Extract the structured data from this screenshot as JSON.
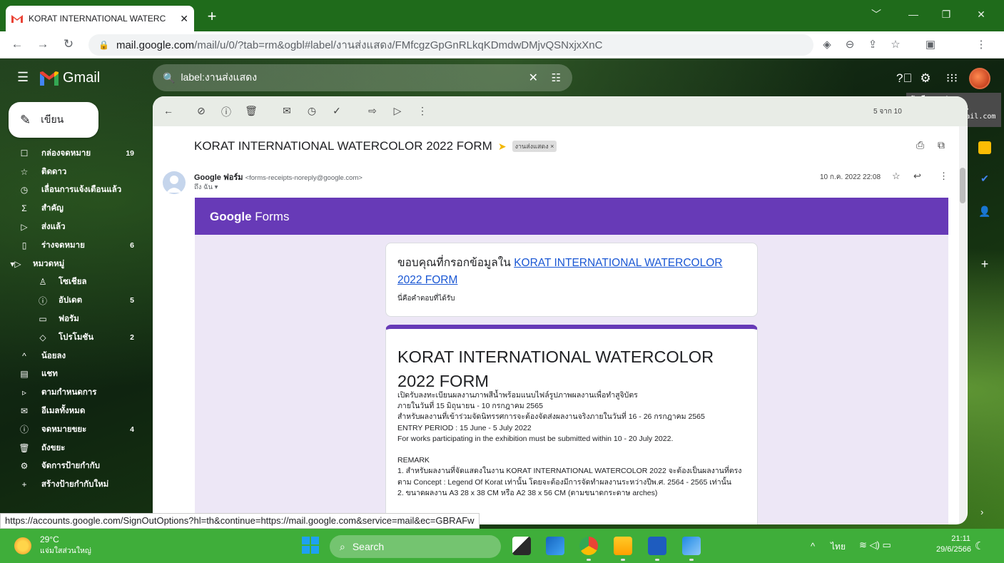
{
  "browser": {
    "tab_title": "KORAT INTERNATIONAL WATERC",
    "tab_close": "✕",
    "new_tab": "+",
    "url_host": "mail.google.com",
    "url_path": "/mail/u/0/?tab=rm&ogbl#label/งานส่งแสดง/FMfcgzGpGnRLkqKDmdwDMjvQSNxjxXnC",
    "status_url": "https://accounts.google.com/SignOutOptions?hl=th&continue=https://mail.google.com&service=mail&ec=GBRAFw"
  },
  "gmail": {
    "app_name": "Gmail",
    "search_query": "label:งานส่งแสดง",
    "account_tooltip": {
      "title": "บัญชี Google",
      "name": "จุฑารัตน์ บุตรเมียน",
      "email": "jutarut.bu@gmail.com"
    },
    "compose_label": "เขียน",
    "sidebar": [
      {
        "icon": "☐",
        "label": "กล่องจดหมาย",
        "count": "19",
        "icon_name": "inbox-icon"
      },
      {
        "icon": "☆",
        "label": "ติดดาว",
        "count": "",
        "icon_name": "star-icon"
      },
      {
        "icon": "◷",
        "label": "เลื่อนการแจ้งเตือนแล้ว",
        "count": "",
        "icon_name": "snooze-icon"
      },
      {
        "icon": "Σ",
        "label": "สำคัญ",
        "count": "",
        "icon_name": "important-icon"
      },
      {
        "icon": "▷",
        "label": "ส่งแล้ว",
        "count": "",
        "icon_name": "sent-icon"
      },
      {
        "icon": "▯",
        "label": "ร่างจดหมาย",
        "count": "6",
        "icon_name": "drafts-icon"
      },
      {
        "icon": "▾▷",
        "label": "หมวดหมู่",
        "count": "",
        "icon_name": "categories-icon"
      },
      {
        "icon": "♙",
        "label": "โซเชียล",
        "count": "",
        "icon_name": "social-icon",
        "sub": true
      },
      {
        "icon": "ⓘ",
        "label": "อัปเดต",
        "count": "5",
        "icon_name": "updates-icon",
        "sub": true
      },
      {
        "icon": "▭",
        "label": "ฟอรัม",
        "count": "",
        "icon_name": "forums-icon",
        "sub": true
      },
      {
        "icon": "◇",
        "label": "โปรโมชัน",
        "count": "2",
        "icon_name": "promotions-icon",
        "sub": true
      },
      {
        "icon": "^",
        "label": "น้อยลง",
        "count": "",
        "icon_name": "less-icon"
      },
      {
        "icon": "▤",
        "label": "แชท",
        "count": "",
        "icon_name": "chat-icon"
      },
      {
        "icon": "▹",
        "label": "ตามกำหนดการ",
        "count": "",
        "icon_name": "scheduled-icon"
      },
      {
        "icon": "✉",
        "label": "อีเมลทั้งหมด",
        "count": "",
        "icon_name": "all-mail-icon"
      },
      {
        "icon": "ⓘ",
        "label": "จดหมายขยะ",
        "count": "4",
        "icon_name": "spam-icon"
      },
      {
        "icon": "🗑",
        "label": "ถังขยะ",
        "count": "",
        "icon_name": "trash-icon"
      },
      {
        "icon": "⚙",
        "label": "จัดการป้ายกำกับ",
        "count": "",
        "icon_name": "manage-labels-icon"
      },
      {
        "icon": "+",
        "label": "สร้างป้ายกำกับใหม่",
        "count": "",
        "icon_name": "create-label-icon"
      }
    ],
    "pager": "5 จาก 10",
    "email": {
      "subject": "KORAT INTERNATIONAL WATERCOLOR 2022 FORM",
      "label_chip": "งานส่งแสดง ×",
      "sender_name": "Google ฟอร์ม",
      "sender_email": "<forms-receipts-noreply@google.com>",
      "to": "ถึง ฉัน ▾",
      "date": "10 ก.ค. 2022 22:08"
    },
    "forms": {
      "logo_google": "Google",
      "logo_forms": " Forms",
      "thanks_prefix": "ขอบคุณที่กรอกข้อมูลใน ",
      "thanks_link": "KORAT INTERNATIONAL WATERCOLOR 2022  FORM",
      "received": "นี่คือคำตอบที่ได้รับ",
      "form_title": "KORAT INTERNATIONAL WATERCOLOR 2022  FORM",
      "description": "เปิดรับลงทะเบียนผลงานภาพสีน้ำพร้อมแนบไฟล์รูปภาพผลงานเพื่อทำสูจิบัตร\nภายในวันที่ 15 มิถุนายน - 10 กรกฎาคม 2565\nสำหรับผลงานที่เข้าร่วมจัดนิทรรศการจะต้องจัดส่งผลงานจริงภายในวันที่ 16 - 26 กรกฎาคม 2565\nENTRY PERIOD : 15 June - 5 July 2022\n For works participating in the exhibition must be submitted within 10 - 20 July 2022.\n\nREMARK\n1. สำหรับผลงานที่จัดแสดงในงาน KORAT INTERNATIONAL WATERCOLOR 2022 จะต้องเป็นผลงานที่ตรงตาม Concept : Legend Of Korat เท่านั้น  โดยจะต้องมีการจัดทำผลงานระหว่างปีพ.ศ.  2564 - 2565 เท่านั้น\n2. ขนาดผลงาน A3  28 x 38 CM หรือ A2  38 x 56 CM (ตามขนาดกระดาษ arches)"
    }
  },
  "taskbar": {
    "temp": "29°C",
    "weather_desc": "แจ่มใสส่วนใหญ่",
    "search_label": "Search",
    "lang": "ไทย",
    "time": "21:11",
    "date": "29/6/2566"
  },
  "colors": {
    "chrome_frame": "#1f6b1b",
    "forms_purple": "#673ab7",
    "taskbar": "#3fae3a",
    "link": "#1a57d4"
  }
}
